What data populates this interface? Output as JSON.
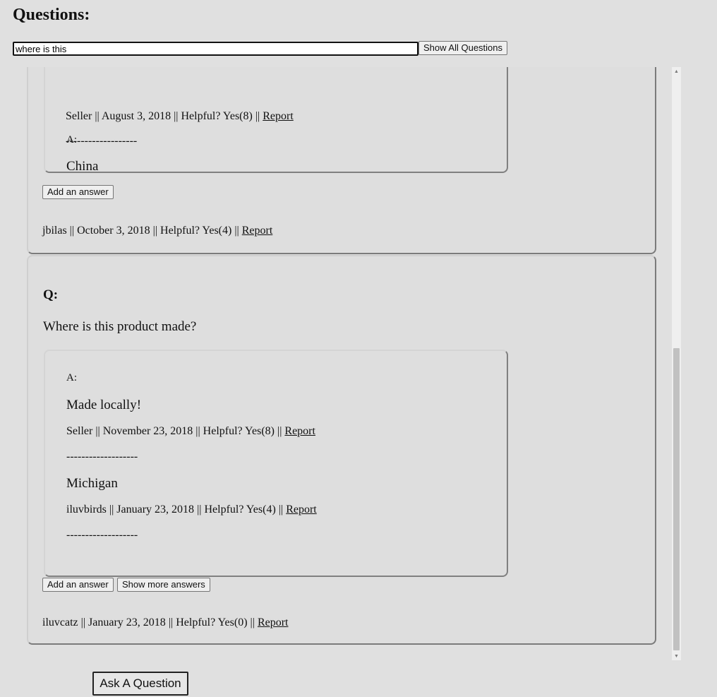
{
  "heading": "Questions:",
  "search": {
    "value": "where is this",
    "placeholder": ""
  },
  "show_all_label": "Show All Questions",
  "answer_prefix": "A:",
  "question_prefix": "Q:",
  "separator": "-------------------",
  "partial_answer_prefix": "A:",
  "q1": {
    "answers": [
      {
        "text": "China",
        "author": "Seller",
        "date": "August 3, 2018",
        "helpful_label": "Helpful? Yes(8)",
        "report": "Report"
      }
    ],
    "add_answer_label": "Add an answer",
    "meta": {
      "author": "jbilas",
      "date": "October 3, 2018",
      "helpful_label": "Helpful? Yes(4)",
      "report": "Report"
    }
  },
  "q2": {
    "question": "Where is this product made?",
    "answers": [
      {
        "text": "Made locally!",
        "author": "Seller",
        "date": "November 23, 2018",
        "helpful_label": "Helpful? Yes(8)",
        "report": "Report"
      },
      {
        "text": "Michigan",
        "author": "iluvbirds",
        "date": "January 23, 2018",
        "helpful_label": "Helpful? Yes(4)",
        "report": "Report"
      }
    ],
    "add_answer_label": "Add an answer",
    "show_more_label": "Show more answers",
    "meta": {
      "author": "iluvcatz",
      "date": "January 23, 2018",
      "helpful_label": "Helpful? Yes(0)",
      "report": "Report"
    }
  },
  "ask_label": "Ask A Question",
  "meta_separator": "||",
  "scroll_icons": {
    "up": "triangle-up-icon",
    "down": "triangle-down-icon"
  }
}
